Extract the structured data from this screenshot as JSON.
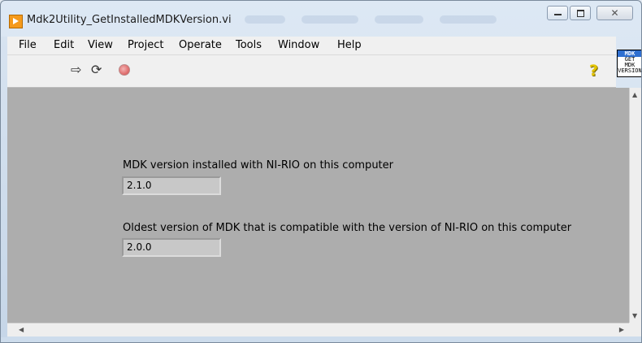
{
  "window": {
    "title": "Mdk2Utility_GetInstalledMDKVersion.vi",
    "controls": {
      "minimize": "",
      "maximize": "",
      "close": "✕"
    }
  },
  "menu": {
    "items": [
      "File",
      "Edit",
      "View",
      "Project",
      "Operate",
      "Tools",
      "Window",
      "Help"
    ]
  },
  "toolbar": {
    "icons": [
      "run-arrow-icon",
      "run-continuously-icon",
      "abort-icon",
      "help-icon"
    ],
    "help_glyph": "?"
  },
  "vi_icon": {
    "line1": "MDK",
    "line2": "GET",
    "line3": "MDK",
    "line4": "VERSION"
  },
  "panel": {
    "installed_label": "MDK version installed with NI-RIO on this computer",
    "installed_value": "2.1.0",
    "oldest_label": "Oldest version of MDK that is compatible with the version of NI-RIO on this computer",
    "oldest_value": "2.0.0"
  },
  "colors": {
    "panel_bg": "#adadad",
    "indicator_bg": "#c8c8c8",
    "labview_icon": "#f59a1b"
  }
}
